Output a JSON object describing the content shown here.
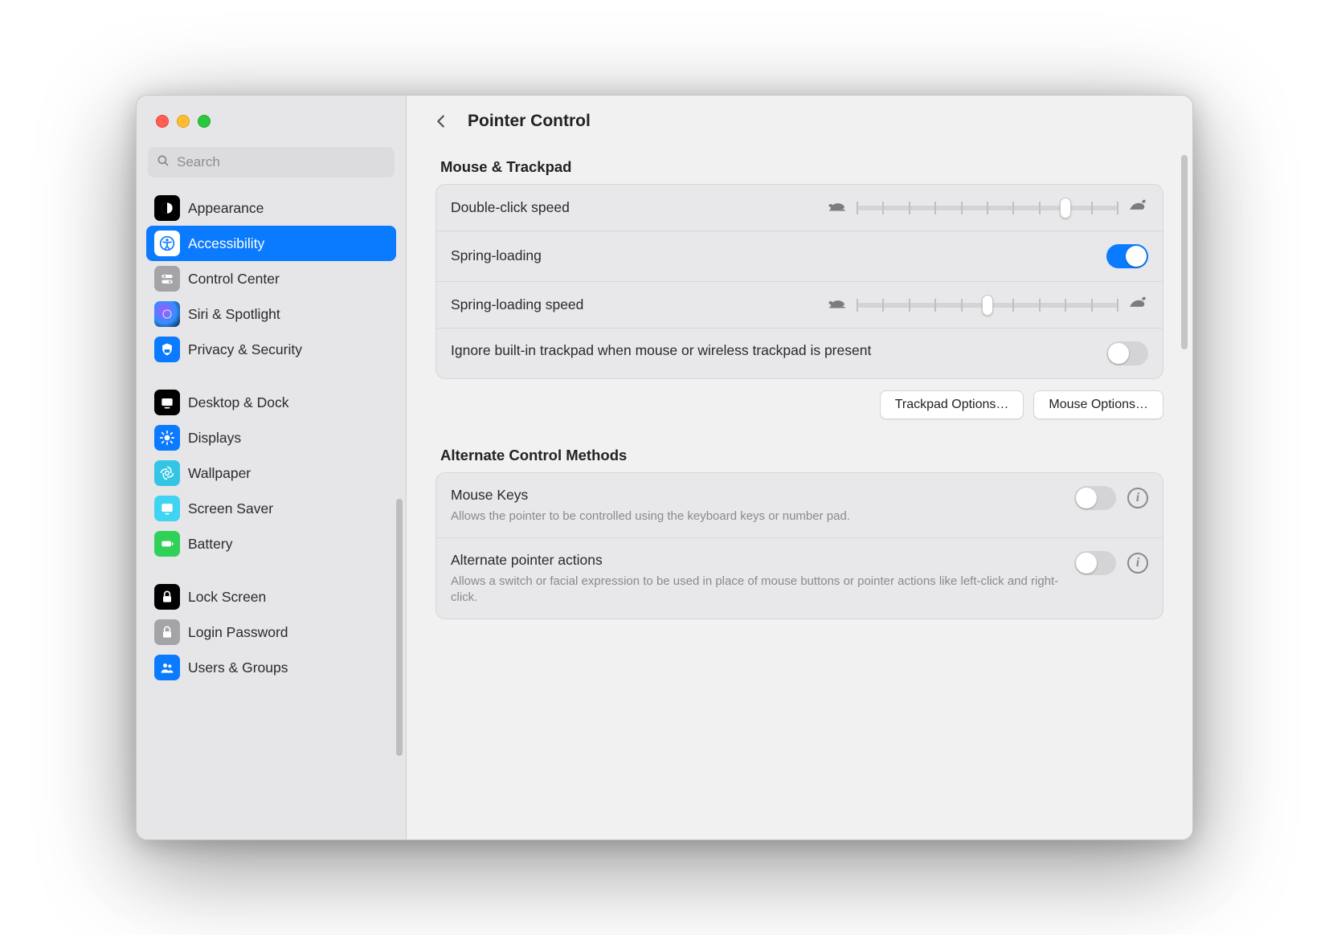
{
  "header": {
    "title": "Pointer Control"
  },
  "search": {
    "placeholder": "Search"
  },
  "sidebar": {
    "groups": [
      {
        "items": [
          {
            "key": "appearance",
            "label": "Appearance"
          },
          {
            "key": "accessibility",
            "label": "Accessibility",
            "selected": true
          },
          {
            "key": "control",
            "label": "Control Center"
          },
          {
            "key": "siri",
            "label": "Siri & Spotlight"
          },
          {
            "key": "privacy",
            "label": "Privacy & Security"
          }
        ]
      },
      {
        "items": [
          {
            "key": "desktop",
            "label": "Desktop & Dock"
          },
          {
            "key": "displays",
            "label": "Displays"
          },
          {
            "key": "wallpaper",
            "label": "Wallpaper"
          },
          {
            "key": "screensaver",
            "label": "Screen Saver"
          },
          {
            "key": "battery",
            "label": "Battery"
          }
        ]
      },
      {
        "items": [
          {
            "key": "lock",
            "label": "Lock Screen"
          },
          {
            "key": "login",
            "label": "Login Password"
          },
          {
            "key": "users",
            "label": "Users & Groups"
          }
        ]
      }
    ]
  },
  "sections": {
    "mouseTrackpad": {
      "title": "Mouse & Trackpad",
      "doubleClick": {
        "label": "Double-click speed",
        "value": 0.8,
        "ticks": 11
      },
      "springLoading": {
        "label": "Spring-loading",
        "on": true
      },
      "springSpeed": {
        "label": "Spring-loading speed",
        "value": 0.5,
        "ticks": 11
      },
      "ignoreTrackpad": {
        "label": "Ignore built-in trackpad when mouse or wireless trackpad is present",
        "on": false
      },
      "buttons": {
        "trackpad": "Trackpad Options…",
        "mouse": "Mouse Options…"
      }
    },
    "altControl": {
      "title": "Alternate Control Methods",
      "mouseKeys": {
        "label": "Mouse Keys",
        "desc": "Allows the pointer to be controlled using the keyboard keys or number pad.",
        "on": false
      },
      "altPointer": {
        "label": "Alternate pointer actions",
        "desc": "Allows a switch or facial expression to be used in place of mouse buttons or pointer actions like left-click and right-click.",
        "on": false
      }
    }
  }
}
